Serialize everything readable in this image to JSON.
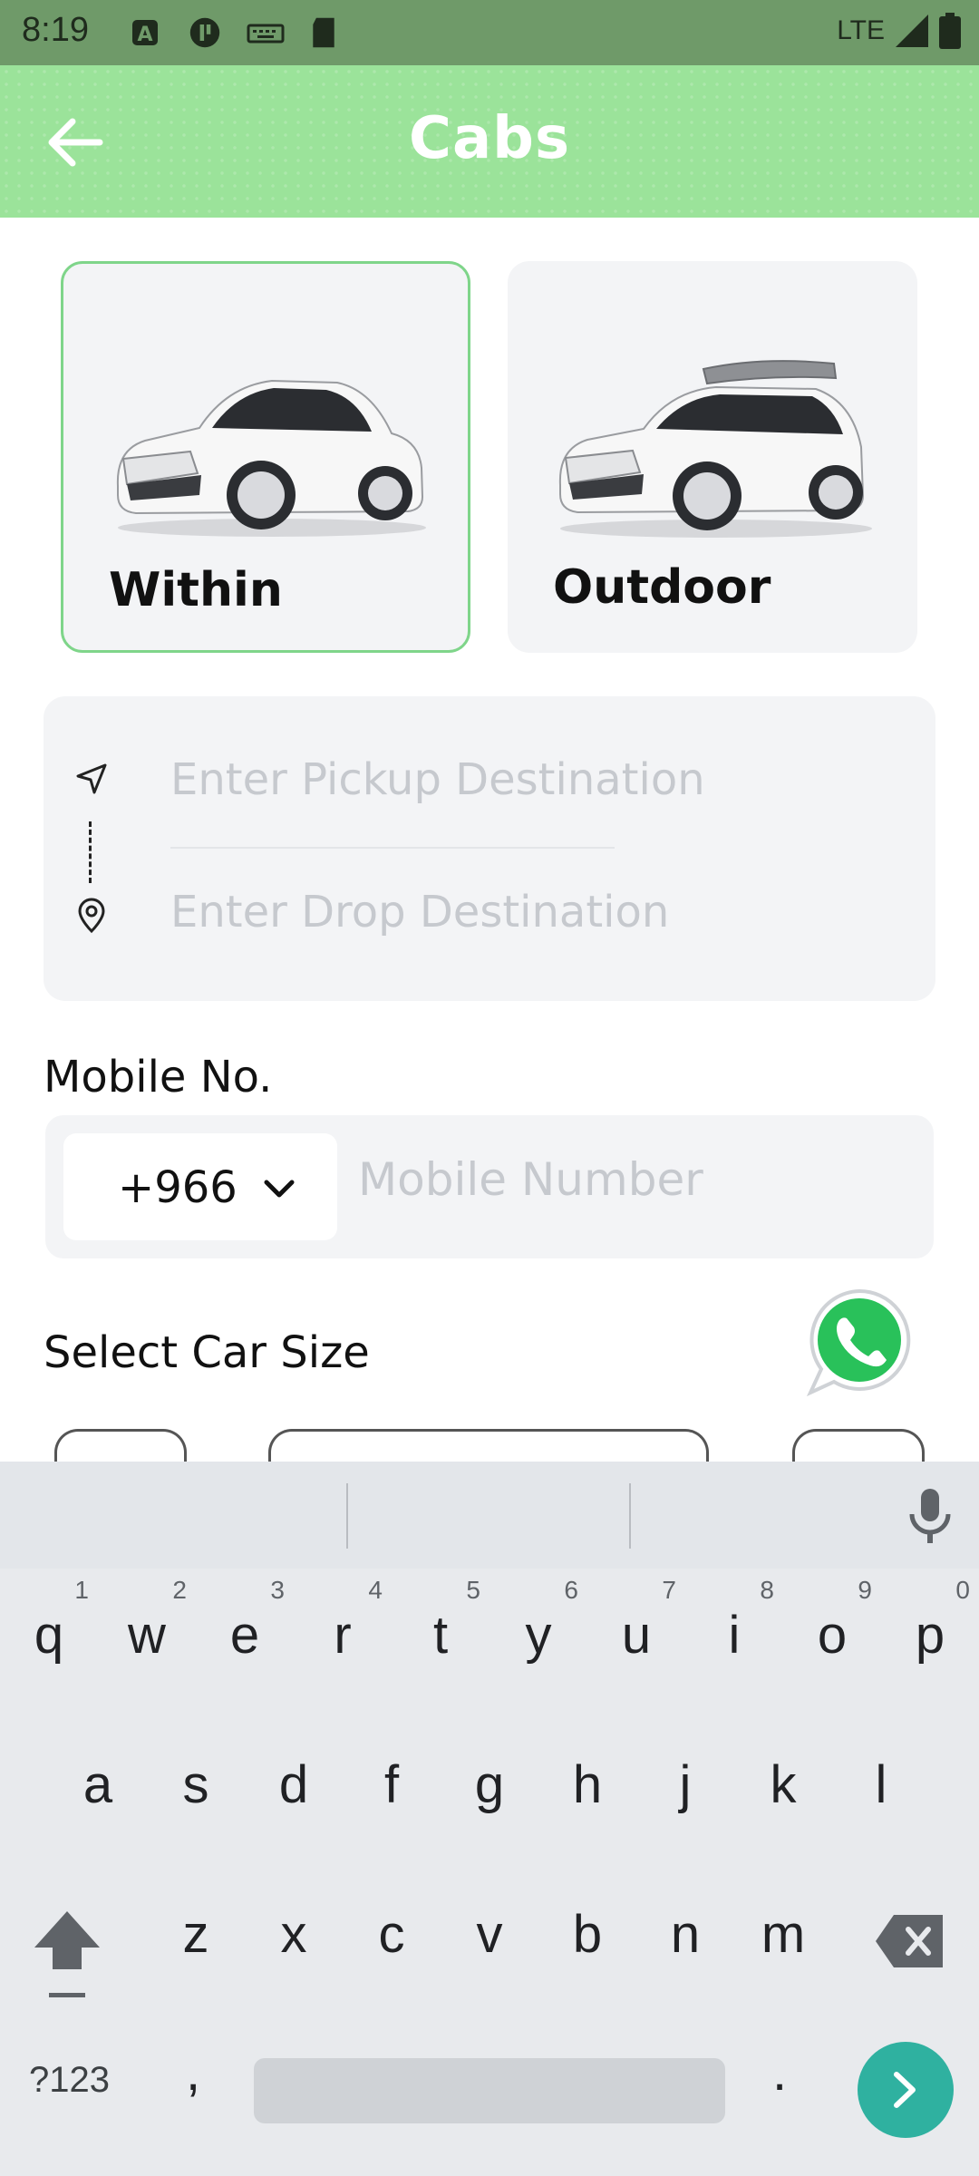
{
  "status_bar": {
    "time": "8:19",
    "network": "LTE"
  },
  "header": {
    "title": "Cabs"
  },
  "trip_types": [
    {
      "label": "Within",
      "selected": true
    },
    {
      "label": "Outdoor",
      "selected": false
    }
  ],
  "destination": {
    "pickup_placeholder": "Enter Pickup Destination",
    "drop_placeholder": "Enter Drop Destination"
  },
  "mobile": {
    "label": "Mobile No.",
    "country_code": "+966",
    "placeholder": "Mobile Number"
  },
  "car_size": {
    "label": "Select Car Size"
  },
  "keyboard": {
    "row1": [
      {
        "ch": "q",
        "num": "1"
      },
      {
        "ch": "w",
        "num": "2"
      },
      {
        "ch": "e",
        "num": "3"
      },
      {
        "ch": "r",
        "num": "4"
      },
      {
        "ch": "t",
        "num": "5"
      },
      {
        "ch": "y",
        "num": "6"
      },
      {
        "ch": "u",
        "num": "7"
      },
      {
        "ch": "i",
        "num": "8"
      },
      {
        "ch": "o",
        "num": "9"
      },
      {
        "ch": "p",
        "num": "0"
      }
    ],
    "row2": [
      "a",
      "s",
      "d",
      "f",
      "g",
      "h",
      "j",
      "k",
      "l"
    ],
    "row3": [
      "z",
      "x",
      "c",
      "v",
      "b",
      "n",
      "m"
    ],
    "symbols": "?123",
    "comma": ",",
    "period": "."
  },
  "colors": {
    "header": "#9be39a",
    "accent": "#2fb1a0",
    "selected_border": "#7fd58a"
  }
}
